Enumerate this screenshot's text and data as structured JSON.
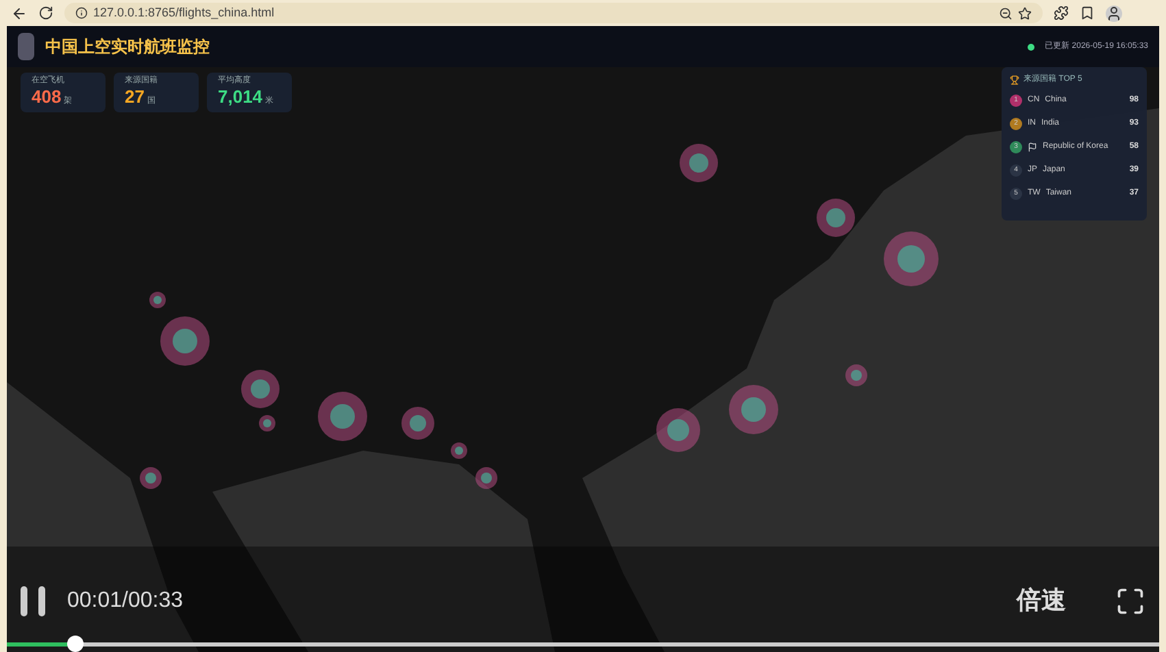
{
  "browser": {
    "url": "127.0.0.1:8765/flights_china.html"
  },
  "header": {
    "title": "中国上空实时航班监控",
    "status": "已更新 2026-05-19 16:05:33"
  },
  "stats": [
    {
      "label": "在空飞机",
      "value": "408",
      "unit": "架",
      "color": "#ff6b4a"
    },
    {
      "label": "来源国籍",
      "value": "27",
      "unit": "国",
      "color": "#f5a623"
    },
    {
      "label": "平均高度",
      "value": "7,014",
      "unit": "米",
      "color": "#3ddc84"
    }
  ],
  "top5": {
    "title": "来源国籍 TOP 5",
    "rows": [
      {
        "rank": "1",
        "code": "CN",
        "name": "China",
        "count": "98",
        "color": "#b0306a"
      },
      {
        "rank": "2",
        "code": "IN",
        "name": "India",
        "count": "93",
        "color": "#b07a20"
      },
      {
        "rank": "3",
        "code": "",
        "name": "Republic of Korea",
        "count": "58",
        "color": "#2f8a5a"
      },
      {
        "rank": "4",
        "code": "JP",
        "name": "Japan",
        "count": "39",
        "color": "#2b3445"
      },
      {
        "rank": "5",
        "code": "TW",
        "name": "Taiwan",
        "count": "37",
        "color": "#2b3445"
      }
    ]
  },
  "player": {
    "playing": true,
    "time": "00:01/00:33",
    "speed": "倍速",
    "level": 0.06
  }
}
